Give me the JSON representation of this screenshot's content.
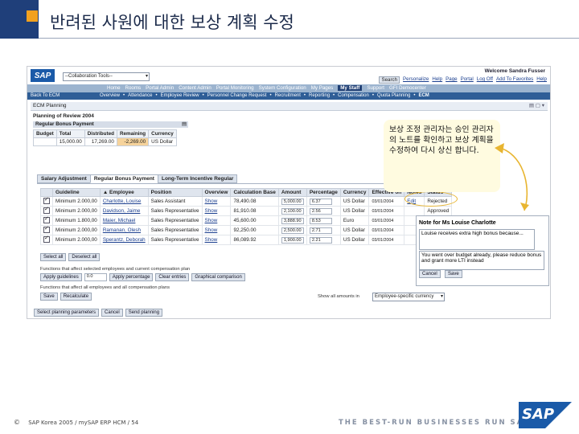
{
  "slide": {
    "title": "반려된 사원에 대한 보상 계획 수정",
    "footer_copyright_symbol": "©",
    "footer_text": "SAP Korea 2005 / mySAP ERP HCM / 54",
    "tagline": "THE BEST-RUN BUSINESSES RUN SAP",
    "logo_text": "SAP",
    "colors": {
      "header_blue": "#1f3f7a",
      "header_orange": "#f2a11f",
      "sap_blue": "#1a5aa8"
    }
  },
  "portal": {
    "logo": "SAP",
    "role_select": "--Collaboration Tools--",
    "welcome": "Welcome Sandra Fusser",
    "search_button": "Search",
    "top_links": [
      "Personalize",
      "Help",
      "Page",
      "Portal",
      "Log Off",
      "Add To Favorites",
      "Help"
    ],
    "nav1": [
      "Home",
      "Rooms",
      "Portal Admin",
      "Content Admin",
      "Portal Monitoring",
      "System Configuration",
      "My Pages",
      "My Staff",
      "Support",
      "GFI Democenter"
    ],
    "nav1_selected": "My Staff",
    "back_link": "Back To ECM",
    "nav2": [
      "Overview",
      "Attendance",
      "Employee Review",
      "Personnel Change Request",
      "Recruitment",
      "Reporting",
      "Compensation",
      "Quota Planning",
      "ECM"
    ],
    "nav2_selected": "ECM"
  },
  "ecm": {
    "panel_title": "ECM Planning",
    "plan_title": "Planning of Review 2004",
    "section_title": "Regular Bonus Payment",
    "budget_headers": [
      "Budget",
      "Total",
      "Distributed",
      "Remaining",
      "Currency"
    ],
    "budget_values": [
      "",
      "15,000.00",
      "17,269.00",
      "-2,269.00",
      "US Dollar"
    ],
    "tabs": [
      "Salary Adjustment",
      "Regular Bonus Payment",
      "Long-Term Incentive Regular"
    ],
    "active_tab": "Regular Bonus Payment",
    "table_headers": [
      "Guideline",
      "▲ Employee",
      "Position",
      "Overview",
      "Calculation Base",
      "Amount",
      "Percentage",
      "Currency",
      "Effective on",
      "Notes",
      "Status"
    ],
    "rows": [
      {
        "guideline": "Minimum 2.000,00",
        "employee": "Charlotte, Louise",
        "position": "Sales Assistant",
        "overview": "Show",
        "base": "78,490.08",
        "amount": "5,000.00",
        "percentage": "6.37",
        "currency": "US Dollar",
        "effective": "03/01/2004",
        "notes": "Edit",
        "status": "Rejected"
      },
      {
        "guideline": "Minimum 2.000,00",
        "employee": "Davidson, Jaime",
        "position": "Sales Representative",
        "overview": "Show",
        "base": "81,910.08",
        "amount": "2,100.00",
        "percentage": "2.56",
        "currency": "US Dollar",
        "effective": "03/01/2004",
        "notes": "",
        "status": "Approved"
      },
      {
        "guideline": "Minimum 1.800,00",
        "employee": "Maier, Michael",
        "position": "Sales Representative",
        "overview": "Show",
        "base": "45,600.00",
        "amount": "3,888.90",
        "percentage": "8.53",
        "currency": "Euro",
        "effective": "03/01/2004",
        "notes": "",
        "status": ""
      },
      {
        "guideline": "Minimum 2.000,00",
        "employee": "Ramanan, Olesh",
        "position": "Sales Representative",
        "overview": "Show",
        "base": "92,250.00",
        "amount": "2,500.00",
        "percentage": "2.71",
        "currency": "US Dollar",
        "effective": "03/01/2004",
        "notes": "",
        "status": ""
      },
      {
        "guideline": "Minimum 2.000,00",
        "employee": "Sperantz, Deborah",
        "position": "Sales Representative",
        "overview": "Show",
        "base": "86,089.92",
        "amount": "1,900.00",
        "percentage": "2.21",
        "currency": "US Dollar",
        "effective": "03/01/2004",
        "notes": "",
        "status": ""
      }
    ],
    "select_all": "Select all",
    "deselect_all": "Deselect all",
    "selected_label": "Functions that affect selected employees and current compensation plan",
    "apply_guidelines": "Apply guidelines",
    "guideline_value": "0.0",
    "apply_percentage": "Apply percentage",
    "clear_entries": "Clear entries",
    "graphical_comparison": "Graphical comparison",
    "all_label": "Functions that affect all employees and all compensation plans",
    "save": "Save",
    "recalculate": "Recalculate",
    "show_amounts_label": "Show all amounts in",
    "show_amounts_value": "Employee-specific currency",
    "select_planning": "Select planning parameters",
    "cancel": "Cancel",
    "send_planning": "Send planning"
  },
  "note": {
    "title": "Note for Ms Louise Charlotte",
    "existing": "Louise receives extra high bonus because...",
    "reply": "You went over budget already, please reduce bonus and grant more LTI instead",
    "cancel": "Cancel",
    "save": "Save"
  },
  "callout": {
    "text": "보상 조정 관리자는 승인 관리자의 노트를 확인하고 보상 계획을 수정하여 다시 상신 합니다."
  }
}
